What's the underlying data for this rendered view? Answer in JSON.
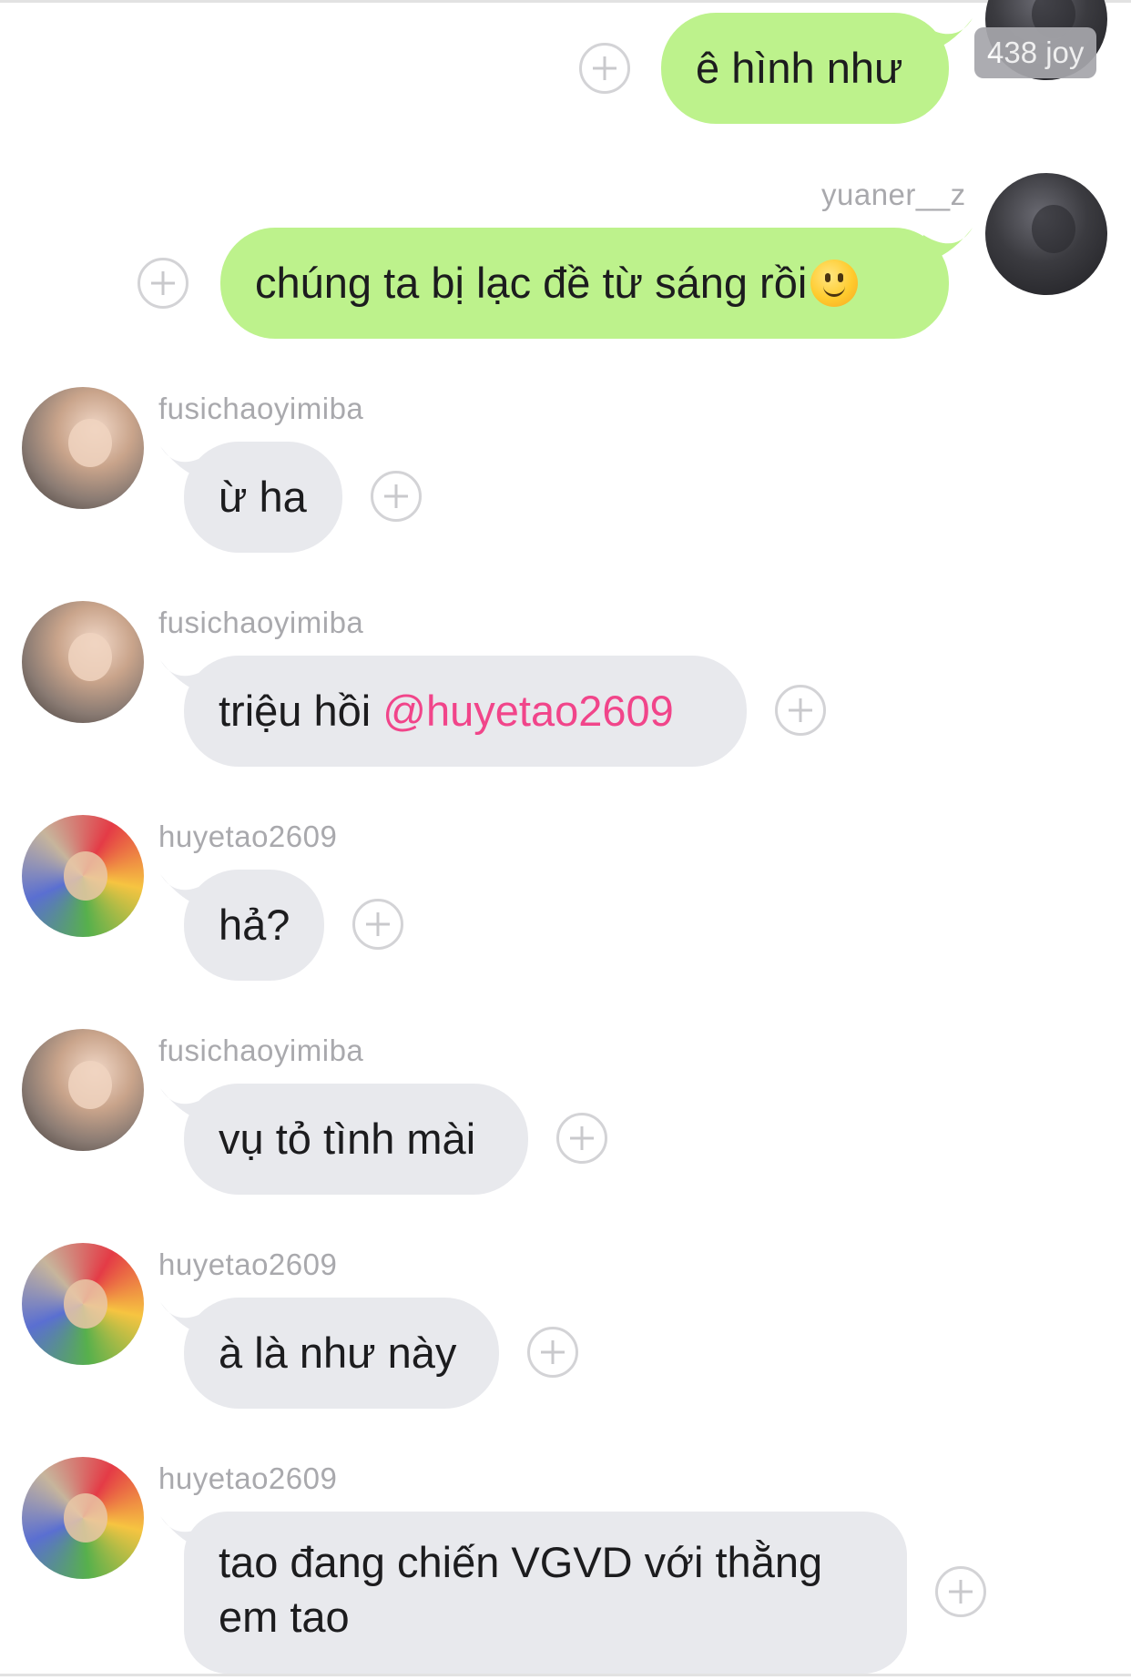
{
  "messages": [
    {
      "sender": "",
      "text": "ê hình như",
      "mine": true,
      "badge": "438 joy"
    },
    {
      "sender": "yuaner__z",
      "text": "chúng ta bị lạc đề từ sáng rồi",
      "emoji": "slightly-smiling-face",
      "mine": true
    },
    {
      "sender": "fusichaoyimiba",
      "text": "ừ ha"
    },
    {
      "sender": "fusichaoyimiba",
      "text": "triệu hồi ",
      "mention": "@huyetao2609"
    },
    {
      "sender": "huyetao2609",
      "text": "hả?"
    },
    {
      "sender": "fusichaoyimiba",
      "text": "vụ tỏ tình mài"
    },
    {
      "sender": "huyetao2609",
      "text": "à là như này"
    },
    {
      "sender": "huyetao2609",
      "text_line1": "tao đang chiến VGVD với thằng",
      "text_line2": "em tao"
    }
  ],
  "colors": {
    "my_bubble": "#bdf28c",
    "their_bubble": "#e8e9ed",
    "mention": "#f1458a",
    "username": "#a9a9ad"
  },
  "icons": [
    "add-reaction-icon",
    "avatar"
  ]
}
